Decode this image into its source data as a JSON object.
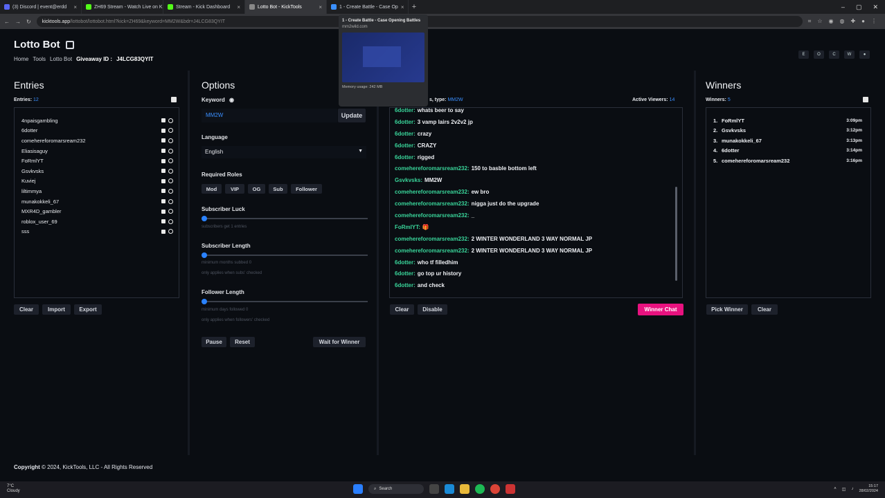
{
  "browser": {
    "tabs": [
      {
        "label": "(3) Discord | event@erdd",
        "color": "#5865f2"
      },
      {
        "label": "ZH69 Stream - Watch Live on K",
        "color": "#53fc18"
      },
      {
        "label": "Stream - Kick Dashboard",
        "color": "#53fc18"
      },
      {
        "label": "Lotto Bot - KickTools",
        "color": "#888888"
      },
      {
        "label": "1 - Create Battle - Case Op",
        "color": "#3a8fff"
      }
    ],
    "url_host": "kicktools.app",
    "url_path": "/lottobot/lottobot.html?kick=ZH69&keyword=MM2W&bdr=J4LCG83QYIT",
    "tab_close": "×",
    "new_tab": "+",
    "win_min": "–",
    "win_max": "▢",
    "win_close": "✕"
  },
  "popup": {
    "title": "1 - Create Battle - Case Opening Battles",
    "domain": "mm2wild.com",
    "memory": "Memory usage: 242 MB"
  },
  "header": {
    "title": "Lotto Bot",
    "breadcrumbs": [
      "Home",
      "Tools",
      "Lotto Bot"
    ],
    "giveaway_label": "Giveaway ID :",
    "giveaway_id": "J4LCG83QYIT",
    "top_icons": [
      "E",
      "O",
      "C",
      "W",
      "●"
    ]
  },
  "entries": {
    "heading": "Entries",
    "count_label": "Entries:",
    "count": "12",
    "items": [
      "4npaisgambling",
      "6dotter",
      "comehereforomarsream232",
      "Eliasisaguy",
      "FoRmlYT",
      "Gsvkvsks",
      "Kuviej",
      "liltimmya",
      "munakokkeli_67",
      "MXR4D_gambler",
      "roblox_user_69",
      "sss"
    ],
    "buttons": {
      "clear": "Clear",
      "import": "Import",
      "export": "Export"
    }
  },
  "options": {
    "heading": "Options",
    "keyword_label": "Keyword",
    "keyword_value": "MM2W",
    "update": "Update",
    "language_label": "Language",
    "language_value": "English",
    "roles_label": "Required Roles",
    "roles": [
      "Mod",
      "VIP",
      "OG",
      "Sub",
      "Follower"
    ],
    "sub_luck_label": "Subscriber Luck",
    "sub_luck_hint": "subscribers get 1 entries",
    "sub_length_label": "Subscriber Length",
    "sub_length_hint1": "minimum months subbed 0",
    "sub_length_hint2": "only applies when subs' checked",
    "follower_label": "Follower Length",
    "follower_hint1": "minimum days followed 0",
    "follower_hint2": "only applies when followers' checked",
    "pause": "Pause",
    "reset": "Reset",
    "wait": "Wait for Winner"
  },
  "chat": {
    "header_prefix": "s, type:",
    "header_type": "MM2W",
    "viewers_label": "Active Viewers:",
    "viewers": "14",
    "messages": [
      {
        "user": "6dotter:",
        "text": "whats beer to say"
      },
      {
        "user": "6dotter:",
        "text": "3 vamp lairs 2v2v2 jp"
      },
      {
        "user": "6dotter:",
        "text": "crazy"
      },
      {
        "user": "6dotter:",
        "text": "CRAZY"
      },
      {
        "user": "6dotter:",
        "text": "rigged"
      },
      {
        "user": "comehereforomarsream232:",
        "text": "150 to basble bottom left"
      },
      {
        "user": "Gsvkvsks:",
        "text": "MM2W"
      },
      {
        "user": "comehereforomarsream232:",
        "text": "ew bro"
      },
      {
        "user": "comehereforomarsream232:",
        "text": "nigga just do the upgrade"
      },
      {
        "user": "comehereforomarsream232:",
        "text": "_"
      },
      {
        "user": "FoRmlYT:",
        "text": "🎁",
        "red": true
      },
      {
        "user": "comehereforomarsream232:",
        "text": "2 WINTER WONDERLAND 3 WAY NORMAL JP"
      },
      {
        "user": "comehereforomarsream232:",
        "text": "2 WINTER WONDERLAND 3 WAY NORMAL JP"
      },
      {
        "user": "6dotter:",
        "text": "who tf filledhim"
      },
      {
        "user": "6dotter:",
        "text": "go top ur history"
      },
      {
        "user": "6dotter:",
        "text": "and check"
      }
    ],
    "clear": "Clear",
    "disable": "Disable",
    "winner_chat": "Winner Chat"
  },
  "winners": {
    "heading": "Winners",
    "count_label": "Winners:",
    "count": "5",
    "items": [
      {
        "num": "1.",
        "name": "FoRmlYT",
        "time": "3:09pm"
      },
      {
        "num": "2.",
        "name": "Gsvkvsks",
        "time": "3:12pm"
      },
      {
        "num": "3.",
        "name": "munakokkeli_67",
        "time": "3:13pm"
      },
      {
        "num": "4.",
        "name": "6dotter",
        "time": "3:14pm"
      },
      {
        "num": "5.",
        "name": "comehereforomarsream232",
        "time": "3:16pm"
      }
    ],
    "pick": "Pick Winner",
    "clear": "Clear"
  },
  "footer": {
    "bold": "Copyright",
    "text": "© 2024, KickTools, LLC - All Rights Reserved"
  },
  "taskbar": {
    "weather_temp": "7°C",
    "weather_desc": "Cloudy",
    "search": "Search",
    "time": "15:17",
    "date": "28/02/2024"
  },
  "colors": {
    "accent": "#e8127f",
    "link": "#3a8fff",
    "chat_user": "#39d59a"
  }
}
